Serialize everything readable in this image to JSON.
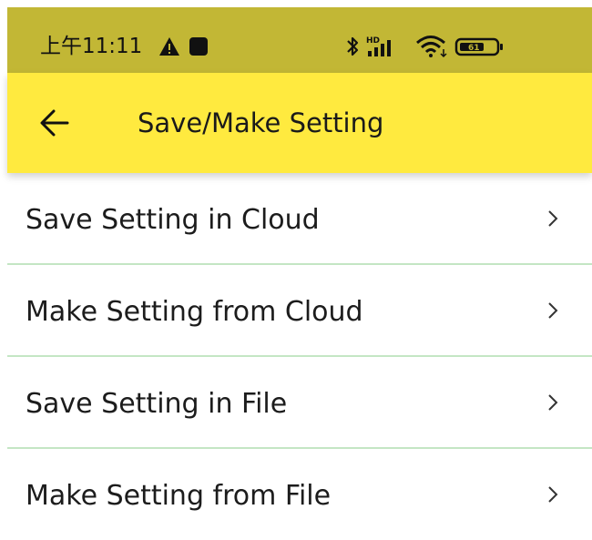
{
  "status_bar": {
    "time": "上午11:11",
    "icons": [
      "warning-icon",
      "stop-icon",
      "bluetooth-icon",
      "hd-signal-icon",
      "wifi-icon",
      "battery-icon"
    ],
    "signal_badge": "HD",
    "battery_level": "61",
    "color": "#c2b735"
  },
  "app_bar": {
    "back_icon": "arrow-left-icon",
    "title": "Save/Make Setting",
    "color": "#ffea3f"
  },
  "menu": {
    "items": [
      {
        "label": "Save Setting in Cloud",
        "icon": "chevron-right-icon"
      },
      {
        "label": "Make Setting from Cloud",
        "icon": "chevron-right-icon"
      },
      {
        "label": "Save Setting in File",
        "icon": "chevron-right-icon"
      },
      {
        "label": "Make Setting from File",
        "icon": "chevron-right-icon"
      }
    ],
    "divider_color": "#c4e6c4"
  }
}
